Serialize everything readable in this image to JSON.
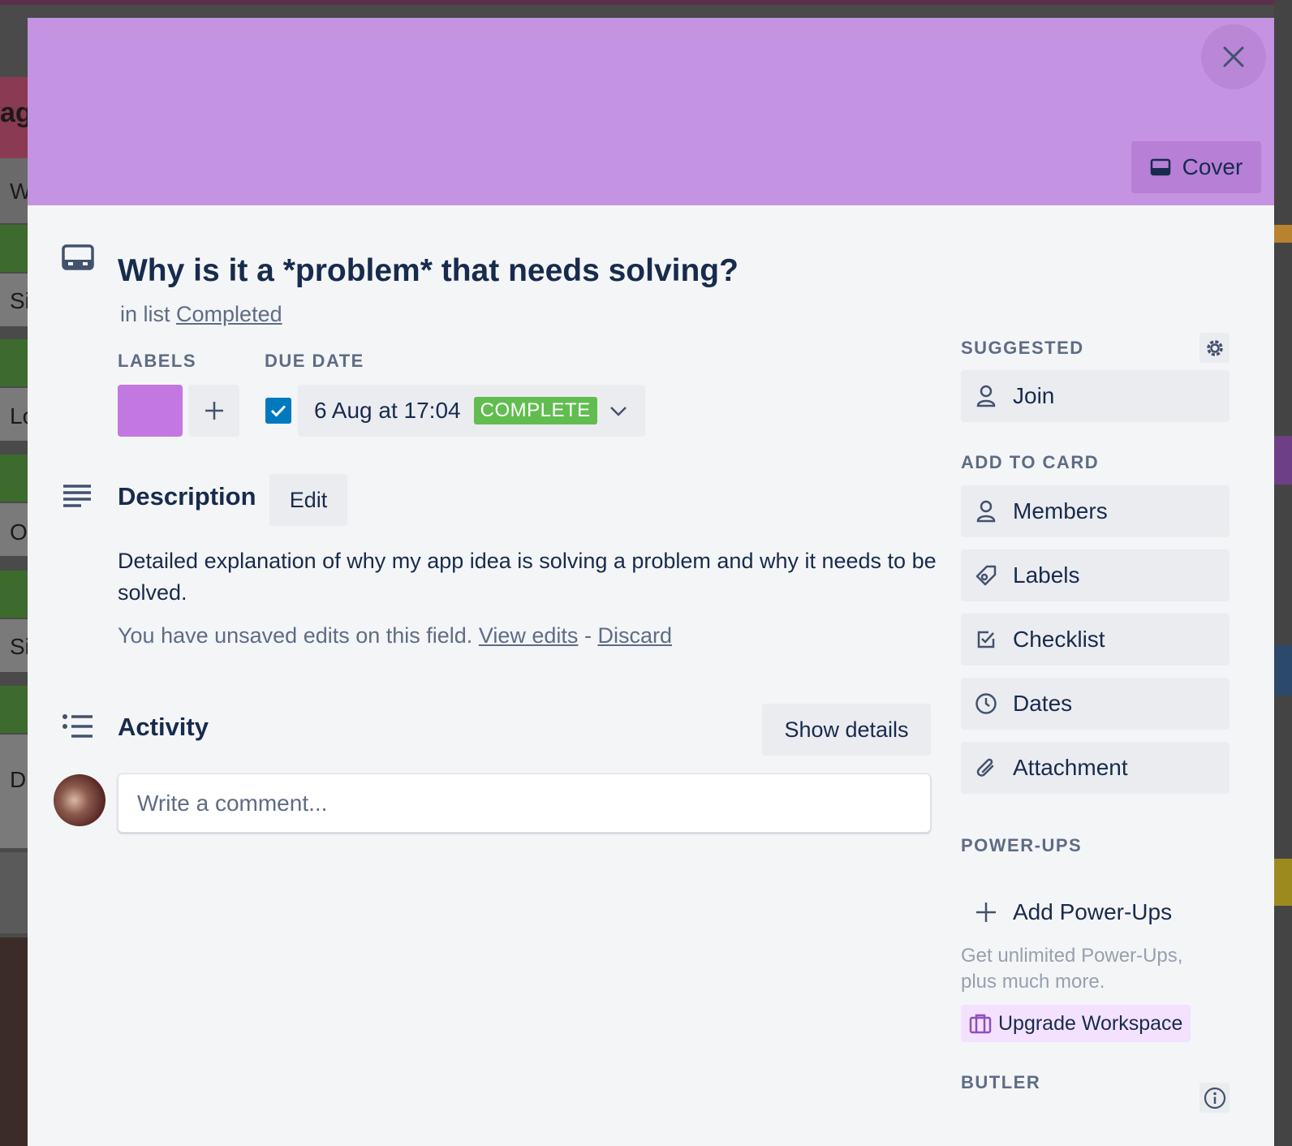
{
  "cover": {
    "button_label": "Cover",
    "color": "#c493e2"
  },
  "card": {
    "title": "Why is it a *problem* that needs solving?",
    "in_list_prefix": "in list",
    "list_name": "Completed"
  },
  "labels": {
    "heading": "LABELS",
    "chip_color": "#c377e0"
  },
  "due_date": {
    "heading": "DUE DATE",
    "value": "6 Aug at 17:04",
    "status": "COMPLETE",
    "checked": true
  },
  "description": {
    "heading": "Description",
    "edit_label": "Edit",
    "text": "Detailed explanation of why my app idea is solving a problem and why it needs to be solved.",
    "unsaved_prefix": "You have unsaved edits on this field.",
    "view_edits": "View edits",
    "separator": "-",
    "discard": "Discard"
  },
  "activity": {
    "heading": "Activity",
    "show_details": "Show details",
    "comment_placeholder": "Write a comment..."
  },
  "sidebar": {
    "suggested_heading": "SUGGESTED",
    "join_label": "Join",
    "add_to_card_heading": "ADD TO CARD",
    "items": [
      {
        "label": "Members",
        "icon": "person-icon"
      },
      {
        "label": "Labels",
        "icon": "tag-icon"
      },
      {
        "label": "Checklist",
        "icon": "checklist-icon"
      },
      {
        "label": "Dates",
        "icon": "clock-icon"
      },
      {
        "label": "Attachment",
        "icon": "paperclip-icon"
      }
    ],
    "powerups_heading": "POWER-UPS",
    "add_powerups": "Add Power-Ups",
    "powerups_note": "Get unlimited Power-Ups, plus much more.",
    "upgrade_label": "Upgrade Workspace",
    "butler_heading": "BUTLER"
  },
  "board_behind": {
    "glyphs": [
      "ag",
      "W",
      "Si",
      "Lo",
      "O",
      "Si",
      "D"
    ]
  }
}
